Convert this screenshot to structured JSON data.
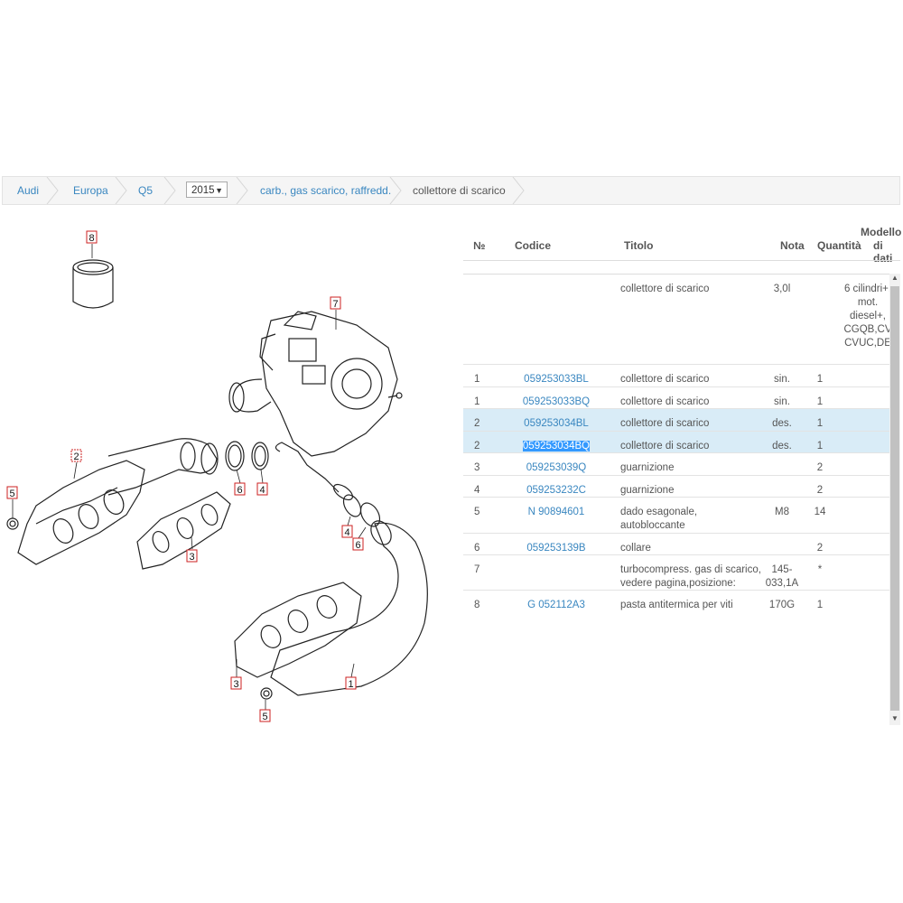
{
  "breadcrumb": {
    "items": [
      "Audi",
      "Europa",
      "Q5",
      "carb., gas scarico, raffredd.",
      "collettore di scarico"
    ],
    "year": "2015"
  },
  "table": {
    "headers": {
      "no": "№",
      "code": "Codice",
      "title": "Titolo",
      "nota": "Nota",
      "qty": "Quantità",
      "model_line1": "Modello",
      "model_line2": "di dati"
    },
    "header_row": {
      "title": "collettore di scarico",
      "nota": "3,0l",
      "model": "6 cilindri+, mot. diesel+, CGQB,CV CVUC,DE"
    },
    "rows": [
      {
        "no": "1",
        "code": "059253033BL",
        "title": "collettore di scarico",
        "nota": "sin.",
        "qty": "1"
      },
      {
        "no": "1",
        "code": "059253033BQ",
        "title": "collettore di scarico",
        "nota": "sin.",
        "qty": "1"
      },
      {
        "no": "2",
        "code": "059253034BL",
        "title": "collettore di scarico",
        "nota": "des.",
        "qty": "1"
      },
      {
        "no": "2",
        "code": "059253034BQ",
        "title": "collettore di scarico",
        "nota": "des.",
        "qty": "1"
      },
      {
        "no": "3",
        "code": "059253039Q",
        "title": "guarnizione",
        "nota": "",
        "qty": "2"
      },
      {
        "no": "4",
        "code": "059253232C",
        "title": "guarnizione",
        "nota": "",
        "qty": "2"
      },
      {
        "no": "5",
        "code": "N 90894601",
        "title": "dado esagonale, autobloccante",
        "nota": "M8",
        "qty": "14"
      },
      {
        "no": "6",
        "code": "059253139B",
        "title": "collare",
        "nota": "",
        "qty": "2"
      },
      {
        "no": "7",
        "code": "",
        "title": "turbocompress. gas di scarico, vedere pagina,posizione:",
        "nota": "145-033,1A",
        "qty": "*"
      },
      {
        "no": "8",
        "code": "G 052112A3",
        "title": "pasta antitermica per viti",
        "nota": "170G",
        "qty": "1"
      }
    ]
  },
  "diagram": {
    "callouts": [
      "8",
      "7",
      "2",
      "6",
      "4",
      "5",
      "3",
      "4",
      "6",
      "3",
      "1",
      "5"
    ]
  },
  "colors": {
    "link": "#3a87c0",
    "selected_row": "#d9ecf7",
    "text_highlight": "#3399ff",
    "callout_box": "#cc2222"
  }
}
